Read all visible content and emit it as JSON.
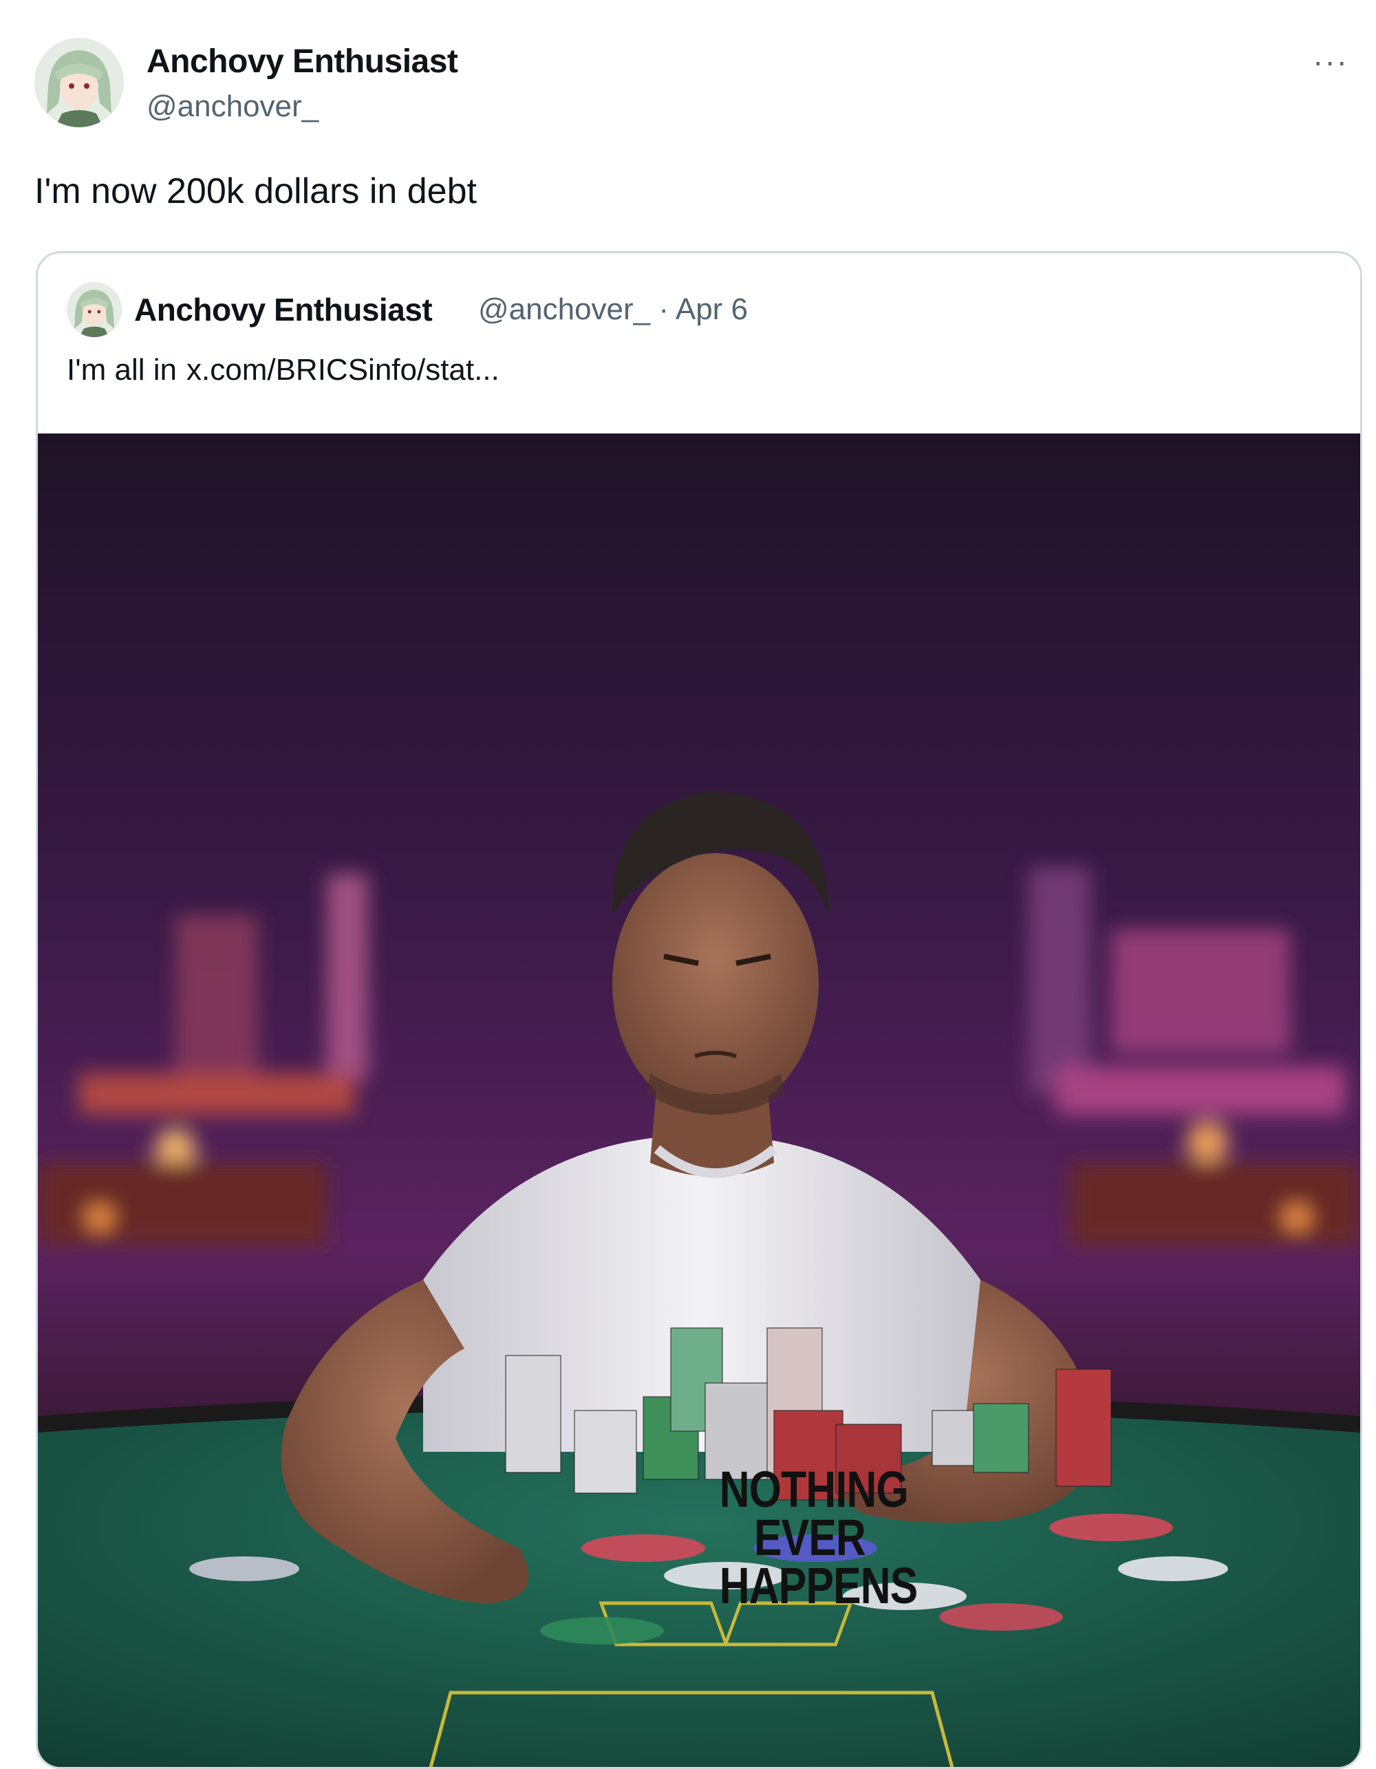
{
  "tweet": {
    "author_name": "Anchovy Enthusiast",
    "author_handle": "@anchover_",
    "more_label": "···",
    "text": "I'm now 200k dollars in debt"
  },
  "quoted_tweet": {
    "author_name": "Anchovy Enthusiast",
    "author_handle": "@anchover_",
    "separator": " · ",
    "date": "Apr 6",
    "text": "I'm all in",
    "link_text": "x.com/BRICSinfo/stat..."
  },
  "media": {
    "shirt_lines": [
      "NOTHING",
      "EVER",
      "HAPPENS"
    ]
  },
  "colors": {
    "secondary_text": "#536471",
    "border": "#cfd9de",
    "table_felt": "#1e5d4c",
    "background_purple": "#4a1e5a"
  }
}
